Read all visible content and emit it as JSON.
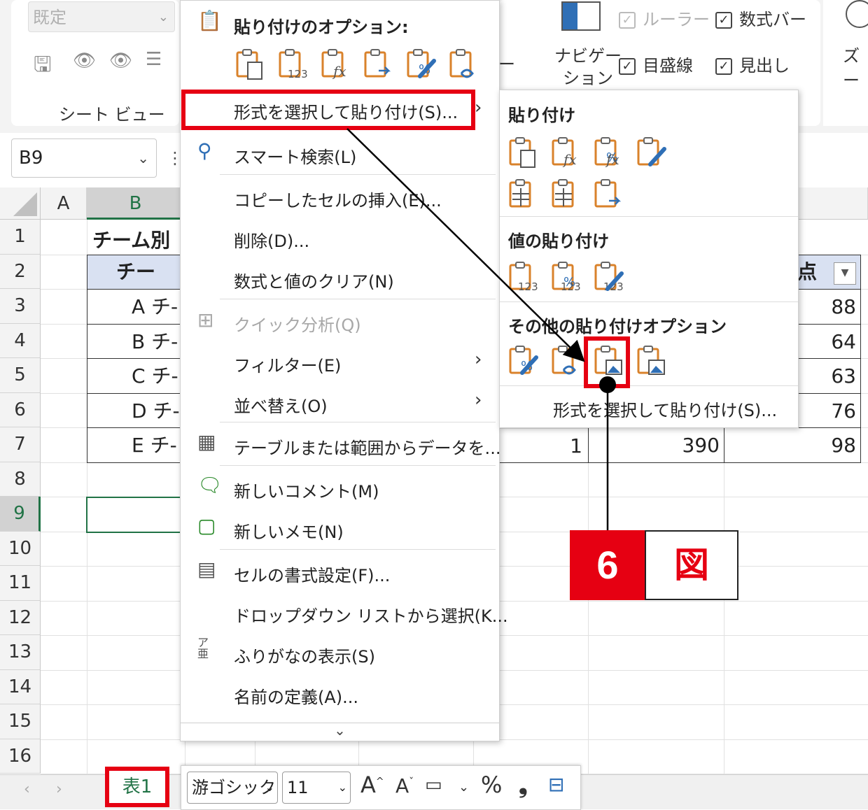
{
  "ribbon": {
    "style_box": "既定",
    "sheet_view_label": "シート ビュー",
    "navigation_label_1": "ナビゲー",
    "navigation_label_2": "ション",
    "ruler": "ルーラー",
    "formula_bar": "数式バー",
    "gridlines": "目盛線",
    "headings": "見出し",
    "zoom": "ズー",
    "dash": "ー"
  },
  "namebox": {
    "value": "B9"
  },
  "columns": [
    "A",
    "B"
  ],
  "rows": [
    "1",
    "2",
    "3",
    "4",
    "5",
    "6",
    "7",
    "8",
    "9",
    "10",
    "11",
    "12",
    "13",
    "14",
    "15",
    "16"
  ],
  "sheet": {
    "title": "チーム別",
    "header_b": "チー",
    "team_rows": [
      "A チ-",
      "B チ-",
      "C チ-",
      "D チ-",
      "E チ-"
    ],
    "header_right": "点",
    "right_values": [
      "88",
      "64",
      "63",
      "76",
      "98"
    ],
    "row7_c1": "1",
    "row7_c2": "390"
  },
  "context_menu": {
    "paste_options_header": "貼り付けのオプション:",
    "items": [
      "形式を選択して貼り付け(S)...",
      "スマート検索(L)",
      "コピーしたセルの挿入(E)...",
      "削除(D)...",
      "数式と値のクリア(N)",
      "クイック分析(Q)",
      "フィルター(E)",
      "並べ替え(O)",
      "テーブルまたは範囲からデータを...",
      "新しいコメント(M)",
      "新しいメモ(N)",
      "セルの書式設定(F)...",
      "ドロップダウン リストから選択(K...",
      "ふりがなの表示(S)",
      "名前の定義(A)..."
    ],
    "furigana_icon": "ア亜",
    "more": "⌄"
  },
  "submenu": {
    "paste_header": "貼り付け",
    "values_header": "値の貼り付け",
    "other_header": "その他の貼り付けオプション",
    "footer": "形式を選択して貼り付け(S)..."
  },
  "callout": {
    "number": "6",
    "label": "図"
  },
  "sheet_tab": {
    "label": "表1"
  },
  "mini_toolbar": {
    "font": "游ゴシック",
    "size": "11",
    "percent": "%",
    "comma": "❟"
  },
  "colors": {
    "accent_red": "#e60012",
    "excel_green": "#217346",
    "header_fill": "#d9e1f2",
    "paste_orange": "#d9822b"
  }
}
